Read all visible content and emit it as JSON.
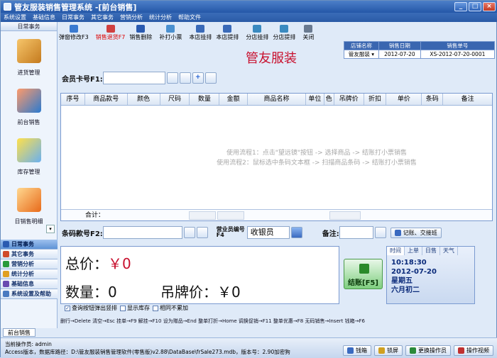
{
  "window": {
    "title": "管友服装销售管理系统  -[前台销售]"
  },
  "menu": [
    "系统设置",
    "基础信息",
    "日常事务",
    "其它事务",
    "营销分析",
    "统计分析",
    "帮助文件"
  ],
  "toolbar": [
    {
      "label": "弹窗修改F3",
      "icon": "popup-edit-icon"
    },
    {
      "label": "销售退货F7",
      "icon": "return-icon",
      "highlight": "#d00000"
    },
    {
      "label": "销售删除",
      "icon": "delete-icon"
    },
    {
      "label": "补打小票",
      "icon": "reprint-icon"
    },
    {
      "label": "本店挂排",
      "icon": "hang-icon"
    },
    {
      "label": "本店提排",
      "icon": "retrieve-icon"
    },
    {
      "label": "分店挂排",
      "icon": "branch-hang-icon"
    },
    {
      "label": "分店提排",
      "icon": "branch-retrieve-icon"
    },
    {
      "label": "关闭",
      "icon": "close-icon"
    }
  ],
  "left_panel": {
    "header": "日常事务",
    "items": [
      {
        "label": "进货管理",
        "icon": "purchase-icon"
      },
      {
        "label": "前台销售",
        "icon": "pos-cart-icon"
      },
      {
        "label": "库存管理",
        "icon": "inventory-icon"
      },
      {
        "label": "日销售明细",
        "icon": "calendar-icon"
      }
    ],
    "nav": [
      "日常事务",
      "其它事务",
      "营销分析",
      "统计分析",
      "基础信息",
      "系统设置及帮助"
    ]
  },
  "shop": {
    "headers": [
      "店铺名称",
      "销售日期",
      "销售单号"
    ],
    "values": [
      "管友服装",
      "2012-07-20",
      "XS-2012-07-20-0001"
    ]
  },
  "brand": "管友服装",
  "member": {
    "label": "会员卡号F1:",
    "value": ""
  },
  "grid": {
    "columns": [
      "序号",
      "商品款号",
      "颜色",
      "尺码",
      "数量",
      "金额",
      "商品名称",
      "单位",
      "色",
      "吊牌价",
      "折扣",
      "单价",
      "条码",
      "备注"
    ],
    "hints": [
      "使用流程1：点击\"望远镜\"按钮 -> 选择商品 -> 结账打小票销售",
      "使用流程2：鼠标选中条码文本框 -> 扫描商品条码 -> 结账打小票销售"
    ],
    "footer": "合计："
  },
  "barcode": {
    "label": "条码款号F2:",
    "staff_label": "营业员编号F4",
    "cashier": "收银员",
    "remark_label": "备注:",
    "account_button": "记账、交接班"
  },
  "summary": {
    "total_label": "总价：",
    "total_value": "￥0",
    "qty_label": "数量：",
    "qty_value": "0",
    "tag_label": "吊牌价：",
    "tag_value": "￥0"
  },
  "checkboxes": [
    {
      "label": "查询按钮弹出竖排",
      "checked": true
    },
    {
      "label": "显示库存",
      "checked": false
    },
    {
      "label": "相同不累加",
      "checked": false
    }
  ],
  "pay_button": "结账[F5]",
  "time_panel": {
    "tabs": [
      "时间",
      "上单",
      "日售",
      "天气"
    ],
    "time": "10:18:30",
    "date": "2012-07-20",
    "weekday": "星期五",
    "lunar": "六月初二"
  },
  "hotkeys": "删行→Delete  清空→Esc   挂单→F9  解挂→F10   设为赠品→End  整单打折→Home  调换促销→F11  整单优惠→F8   无码销售→Insert   钱箱→F6",
  "doc_tab": "前台销售",
  "status": {
    "operator": "当前操作员: admin",
    "db": "Access版本，数据库路径：D:\\管友服装销售管理软件(零售版)v2.88\\DataBase\\frSale273.mdb，版本号：2.90加密狗"
  },
  "status_buttons": [
    "钱箱",
    "锁屏",
    "更换操作员",
    "操作视频"
  ],
  "colors": {
    "accent": "#2457a8",
    "red": "#c8102e"
  }
}
